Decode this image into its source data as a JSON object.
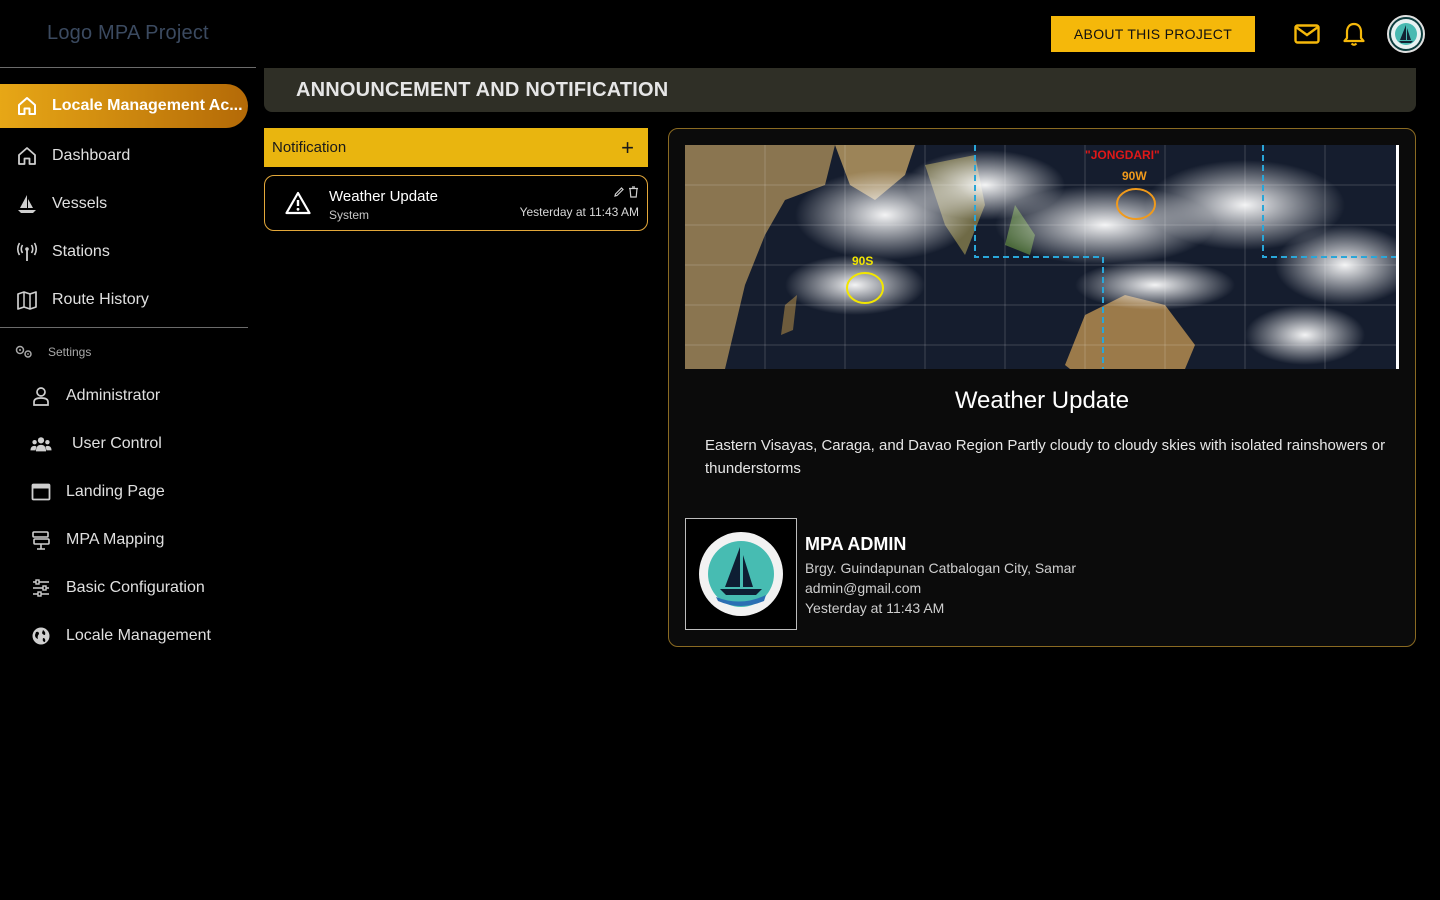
{
  "app": {
    "logo_text": "Logo MPA Project",
    "about_button": "ABOUT THIS PROJECT",
    "icons": {
      "mail": "mail-icon",
      "bell": "bell-icon",
      "avatar": "mpa-logo"
    },
    "accent_color": "#f5b80a"
  },
  "sidebar": {
    "active": {
      "label": "Locale Management Ac...",
      "icon": "home-icon"
    },
    "items": [
      {
        "label": "Dashboard",
        "icon": "home-icon"
      },
      {
        "label": "Vessels",
        "icon": "ship-icon"
      },
      {
        "label": "Stations",
        "icon": "antenna-icon"
      },
      {
        "label": "Route History",
        "icon": "map-icon"
      }
    ],
    "settings_label": "Settings",
    "settings_items": [
      {
        "label": "Administrator",
        "icon": "user-icon"
      },
      {
        "label": "User Control",
        "icon": "users-icon"
      },
      {
        "label": "Landing Page",
        "icon": "window-icon"
      },
      {
        "label": "MPA Mapping",
        "icon": "signpost-icon"
      },
      {
        "label": "Basic Configuration",
        "icon": "sliders-icon"
      },
      {
        "label": "Locale Management",
        "icon": "globe-icon"
      }
    ]
  },
  "header": {
    "title": "ANNOUNCEMENT AND NOTIFICATION"
  },
  "notifications": {
    "panel_label": "Notification",
    "add_symbol": "+",
    "items": [
      {
        "title": "Weather Update",
        "source": "System",
        "time": "Yesterday at 11:43 AM",
        "icon": "warning-icon"
      }
    ]
  },
  "detail": {
    "image_labels": {
      "storm1": "90S",
      "storm2": "90W",
      "storm_name": "\"JONGDARI\""
    },
    "title": "Weather Update",
    "body": "Eastern Visayas, Caraga, and Davao Region Partly cloudy to cloudy skies with isolated rainshowers or thunderstorms",
    "author": {
      "name": "MPA ADMIN",
      "address": "Brgy. Guindapunan Catbalogan City, Samar",
      "email": "admin@gmail.com",
      "time": "Yesterday at 11:43 AM"
    }
  }
}
